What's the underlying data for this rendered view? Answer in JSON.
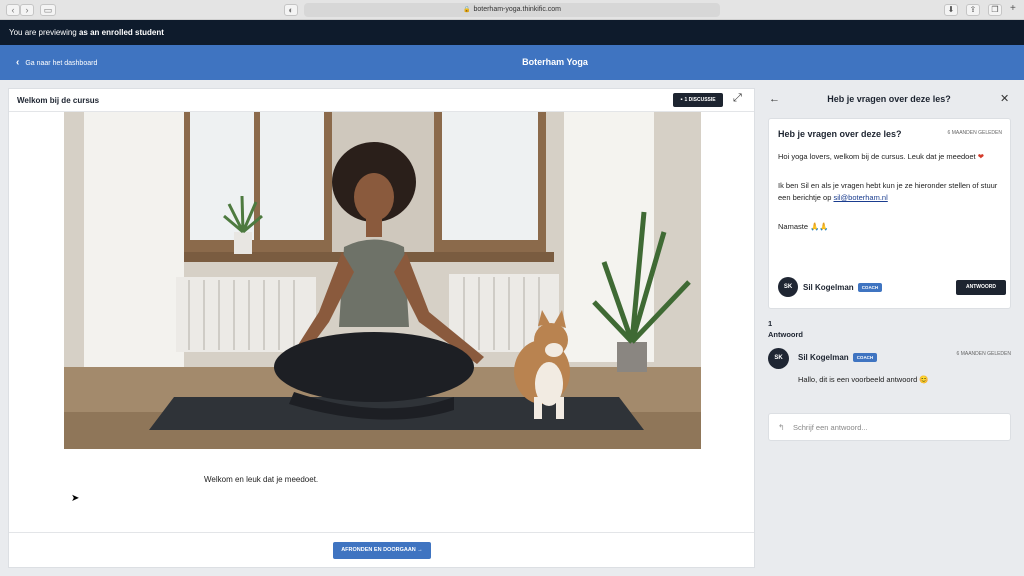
{
  "browser": {
    "url": "boterham-yoga.thinkific.com"
  },
  "preview_banner": {
    "prefix": "You are previewing ",
    "bold": "as an enrolled student"
  },
  "header": {
    "back_label": "Ga naar het dashboard",
    "site_title": "Boterham Yoga"
  },
  "lesson": {
    "title": "Welkom bij de cursus",
    "discussion_label": "1 DISCUSSIE",
    "body_text": "Welkom en leuk dat je meedoet.",
    "complete_label": "AFRONDEN EN DOORGAAN →"
  },
  "discussion": {
    "panel_title": "Heb je vragen over deze les?",
    "question": {
      "title": "Heb je vragen over deze les?",
      "time": "6 MAANDEN GELEDEN",
      "line1": "Hoi yoga lovers, welkom bij de cursus. Leuk dat je meedoet",
      "line2_prefix": "Ik ben Sil en als je vragen hebt kun je ze hieronder stellen of stuur een berichtje op ",
      "email": "sil@boterham.nl",
      "line3": "Namaste 🙏🙏",
      "author_initials": "SK",
      "author_name": "Sil Kogelman",
      "author_badge": "COACH",
      "reply_label": "ANTWOORD"
    },
    "answer_count_number": "1",
    "answer_count_label": "Antwoord",
    "answers": [
      {
        "initials": "SK",
        "name": "Sil Kogelman",
        "badge": "COACH",
        "time": "6 MAANDEN GELEDEN",
        "text": "Hallo, dit is een voorbeeld antwoord 😊"
      }
    ],
    "reply_placeholder": "Schrijf een antwoord..."
  }
}
